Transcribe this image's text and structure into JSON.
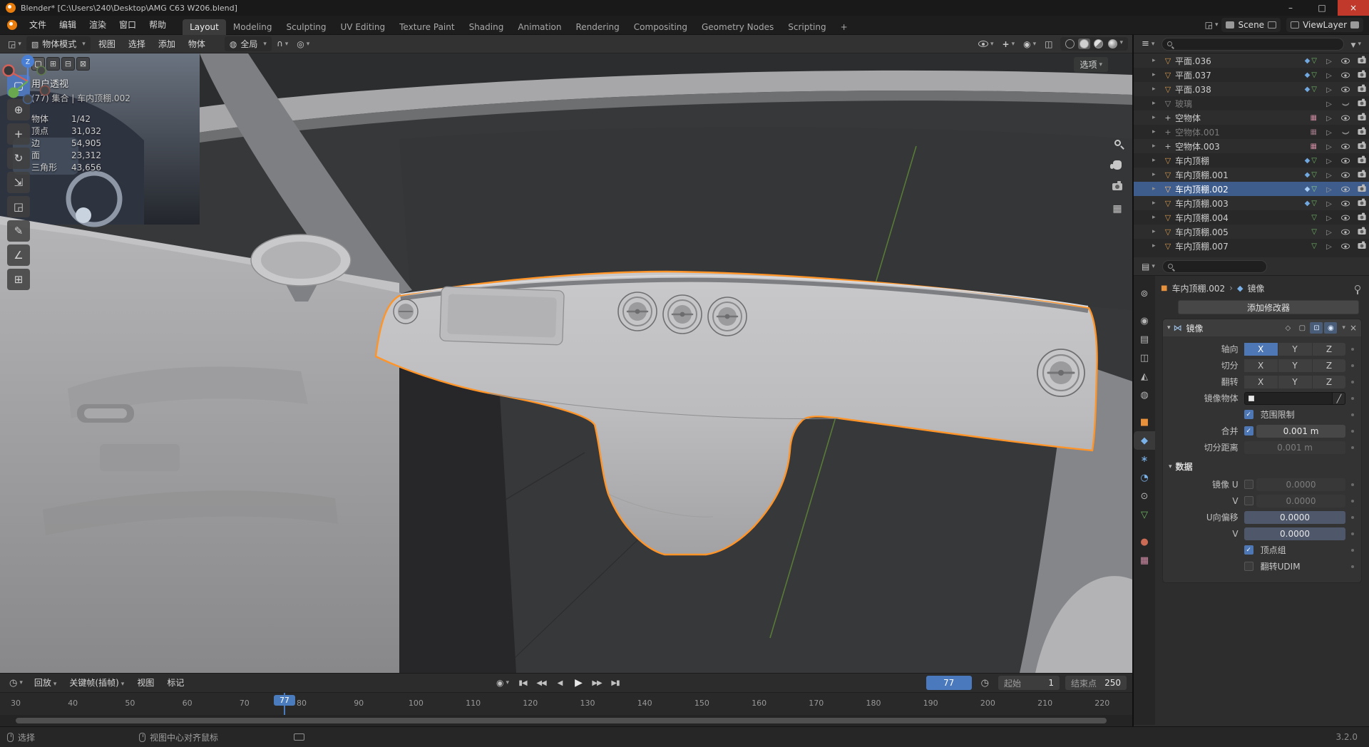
{
  "colors": {
    "accent": "#4772b3",
    "selection_outline": "#ff9428",
    "object_orange": "#e8913d"
  },
  "titlebar": {
    "title": "Blender* [C:\\Users\\240\\Desktop\\AMG C63 W206.blend]",
    "buttons": [
      {
        "name": "minimize-button",
        "glyph": "–"
      },
      {
        "name": "maximize-button",
        "glyph": "□"
      },
      {
        "name": "close-button",
        "glyph": "×",
        "close": true
      }
    ]
  },
  "topbar": {
    "menus": [
      {
        "label": "文件"
      },
      {
        "label": "编辑"
      },
      {
        "label": "渲染"
      },
      {
        "label": "窗口"
      },
      {
        "label": "帮助"
      }
    ],
    "workspaces": [
      {
        "label": "Layout",
        "active": true
      },
      {
        "label": "Modeling"
      },
      {
        "label": "Sculpting"
      },
      {
        "label": "UV Editing"
      },
      {
        "label": "Texture Paint"
      },
      {
        "label": "Shading"
      },
      {
        "label": "Animation"
      },
      {
        "label": "Rendering"
      },
      {
        "label": "Compositing"
      },
      {
        "label": "Geometry Nodes"
      },
      {
        "label": "Scripting"
      },
      {
        "label": "+"
      }
    ],
    "scene_label": "Scene",
    "viewlayer_label": "ViewLayer"
  },
  "viewport": {
    "header": {
      "mode": "物体模式",
      "menus": [
        {
          "label": "视图"
        },
        {
          "label": "选择"
        },
        {
          "label": "添加"
        },
        {
          "label": "物体"
        }
      ],
      "orientation": "全局"
    },
    "tool_settings": {
      "options_label": "选项",
      "select_modes": [
        {
          "name": "select-mode-set",
          "glyph": "▢",
          "active": true
        },
        {
          "name": "select-mode-extend",
          "glyph": "⊞"
        },
        {
          "name": "select-mode-subtract",
          "glyph": "⊟"
        },
        {
          "name": "select-mode-intersect",
          "glyph": "⊠"
        }
      ]
    },
    "toolbar": [
      {
        "name": "select-box-tool",
        "glyph": "▢",
        "active": true
      },
      {
        "name": "cursor-tool",
        "glyph": "⊕"
      },
      {
        "name": "move-tool",
        "glyph": "+"
      },
      {
        "name": "rotate-tool",
        "glyph": "↻"
      },
      {
        "name": "scale-tool",
        "glyph": "⇲"
      },
      {
        "name": "transform-tool",
        "glyph": "◲"
      },
      {
        "name": "annotate-tool",
        "glyph": "✎"
      },
      {
        "name": "measure-tool",
        "glyph": "∠"
      },
      {
        "name": "add-cube-tool",
        "glyph": "⊞"
      }
    ],
    "overlay": {
      "view_label": "用户透视",
      "context_label": "(77) 集合 | 车内顶棚.002",
      "stats": [
        {
          "label": "物体",
          "value": "1/42"
        },
        {
          "label": "顶点",
          "value": "31,032"
        },
        {
          "label": "边",
          "value": "54,905"
        },
        {
          "label": "面",
          "value": "23,312"
        },
        {
          "label": "三角形",
          "value": "43,656"
        }
      ]
    },
    "gizmo": {
      "z_label": "Z"
    }
  },
  "outliner": {
    "rows": [
      {
        "name": "平面.036",
        "icon": {
          "g": "▽",
          "c": "#cf9850"
        },
        "badges": [
          {
            "n": "modifier-badge",
            "g": "◆",
            "c": "#71a8e0"
          },
          {
            "n": "mesh-data-badge",
            "g": "▽",
            "c": "#6db563"
          }
        ]
      },
      {
        "name": "平面.037",
        "icon": {
          "g": "▽",
          "c": "#cf9850"
        },
        "badges": [
          {
            "n": "modifier-badge",
            "g": "◆",
            "c": "#71a8e0"
          },
          {
            "n": "mesh-data-badge",
            "g": "▽",
            "c": "#6db563"
          }
        ]
      },
      {
        "name": "平面.038",
        "icon": {
          "g": "▽",
          "c": "#cf9850"
        },
        "badges": [
          {
            "n": "modifier-badge",
            "g": "◆",
            "c": "#71a8e0"
          },
          {
            "n": "mesh-data-badge",
            "g": "▽",
            "c": "#6db563"
          }
        ]
      },
      {
        "name": "玻璃",
        "dim": true,
        "eyeClosed": true,
        "icon": {
          "g": "▽",
          "c": "#8e8e8e"
        },
        "badges": []
      },
      {
        "name": "空物体",
        "icon": {
          "g": "+",
          "c": "#c0c0c0"
        },
        "badges": [
          {
            "n": "image-badge",
            "g": "▦",
            "c": "#c9899f"
          }
        ]
      },
      {
        "name": "空物体.001",
        "dim": true,
        "eyeClosed": true,
        "icon": {
          "g": "+",
          "c": "#8e8e8e"
        },
        "badges": [
          {
            "n": "image-badge",
            "g": "▦",
            "c": "#9a7583"
          }
        ]
      },
      {
        "name": "空物体.003",
        "icon": {
          "g": "+",
          "c": "#c0c0c0"
        },
        "badges": [
          {
            "n": "image-badge",
            "g": "▦",
            "c": "#c9899f"
          }
        ]
      },
      {
        "name": "车内顶棚",
        "icon": {
          "g": "▽",
          "c": "#cf9850"
        },
        "badges": [
          {
            "n": "modifier-badge",
            "g": "◆",
            "c": "#71a8e0"
          },
          {
            "n": "mesh-data-badge",
            "g": "▽",
            "c": "#6db563"
          }
        ]
      },
      {
        "name": "车内顶棚.001",
        "icon": {
          "g": "▽",
          "c": "#cf9850"
        },
        "badges": [
          {
            "n": "modifier-badge",
            "g": "◆",
            "c": "#71a8e0"
          },
          {
            "n": "mesh-data-badge",
            "g": "▽",
            "c": "#6db563"
          }
        ]
      },
      {
        "name": "车内顶棚.002",
        "selected": true,
        "icon": {
          "g": "▽",
          "c": "#ffc27a"
        },
        "badges": [
          {
            "n": "modifier-badge",
            "g": "◆",
            "c": "#a8cdf2"
          },
          {
            "n": "mesh-data-badge",
            "g": "▽",
            "c": "#8fd687"
          }
        ]
      },
      {
        "name": "车内顶棚.003",
        "icon": {
          "g": "▽",
          "c": "#cf9850"
        },
        "badges": [
          {
            "n": "modifier-badge",
            "g": "◆",
            "c": "#71a8e0"
          },
          {
            "n": "mesh-data-badge",
            "g": "▽",
            "c": "#6db563"
          }
        ]
      },
      {
        "name": "车内顶棚.004",
        "icon": {
          "g": "▽",
          "c": "#cf9850"
        },
        "badges": [
          {
            "n": "mesh-data-badge",
            "g": "▽",
            "c": "#6db563"
          }
        ]
      },
      {
        "name": "车内顶棚.005",
        "icon": {
          "g": "▽",
          "c": "#cf9850"
        },
        "badges": [
          {
            "n": "mesh-data-badge",
            "g": "▽",
            "c": "#6db563"
          }
        ]
      },
      {
        "name": "车内顶棚.007",
        "icon": {
          "g": "▽",
          "c": "#cf9850"
        },
        "badges": [
          {
            "n": "mesh-data-badge",
            "g": "▽",
            "c": "#6db563"
          }
        ]
      }
    ]
  },
  "properties": {
    "tabs": [
      {
        "name": "tool",
        "glyph": "⊚",
        "color": "#b5b5b5"
      },
      {
        "name": "render",
        "glyph": "◉",
        "color": "#b5b5b5",
        "gap": true
      },
      {
        "name": "output",
        "glyph": "▤",
        "color": "#b5b5b5"
      },
      {
        "name": "view-layer",
        "glyph": "◫",
        "color": "#b5b5b5"
      },
      {
        "name": "scene",
        "glyph": "◭",
        "color": "#b5b5b5"
      },
      {
        "name": "world",
        "glyph": "◍",
        "color": "#b5b5b5"
      },
      {
        "name": "object",
        "glyph": "■",
        "color": "#e8913d",
        "gap": true
      },
      {
        "name": "modifiers",
        "glyph": "◆",
        "color": "#79b1e8",
        "active": true
      },
      {
        "name": "particles",
        "glyph": "∗",
        "color": "#79b1e8"
      },
      {
        "name": "physics",
        "glyph": "◔",
        "color": "#79b1e8"
      },
      {
        "name": "constraints",
        "glyph": "⊙",
        "color": "#b5b5b5"
      },
      {
        "name": "object-data",
        "glyph": "▽",
        "color": "#6db563"
      },
      {
        "name": "material",
        "glyph": "●",
        "color": "#cb6a55",
        "gap": true
      },
      {
        "name": "texture",
        "glyph": "▦",
        "color": "#cf8ca5"
      }
    ],
    "breadcrumb": {
      "object": "车内顶棚.002",
      "separator": "›",
      "modifier": "镜像"
    },
    "add_modifier_label": "添加修改器",
    "modifier_panel": {
      "name": "镜像",
      "expand_glyph": "▾",
      "header_toggles": [
        {
          "name": "toggle-on-cage",
          "glyph": "◇"
        },
        {
          "name": "toggle-edit-mode",
          "glyph": "▢"
        },
        {
          "name": "toggle-realtime",
          "glyph": "⊡",
          "active": true
        },
        {
          "name": "toggle-render",
          "glyph": "◉",
          "active": true
        }
      ],
      "close_glyph": "×",
      "axis_rows": [
        {
          "label": "轴向",
          "name": "axis",
          "buttons": [
            {
              "t": "X",
              "active": true
            },
            {
              "t": "Y"
            },
            {
              "t": "Z"
            }
          ]
        },
        {
          "label": "切分",
          "name": "bisect",
          "buttons": [
            {
              "t": "X"
            },
            {
              "t": "Y"
            },
            {
              "t": "Z"
            }
          ]
        },
        {
          "label": "翻转",
          "name": "flip",
          "buttons": [
            {
              "t": "X"
            },
            {
              "t": "Y"
            },
            {
              "t": "Z"
            }
          ]
        }
      ],
      "mirror_object_label": "镜像物体",
      "clipping_label": "范围限制",
      "merge_label": "合并",
      "merge_value": "0.001 m",
      "bisect_distance_label": "切分距离",
      "bisect_distance_value": "0.001 m",
      "data_section_label": "数据",
      "mirror_u_label": "镜像 U",
      "mirror_u_value": "0.0000",
      "mirror_v_label": "V",
      "mirror_v_value": "0.0000",
      "offset_u_label": "U向偏移",
      "offset_u_value": "0.0000",
      "offset_v_label": "V",
      "offset_v_value": "0.0000",
      "vertex_groups_label": "顶点组",
      "flip_udim_label": "翻转UDIM"
    }
  },
  "timeline": {
    "menus": [
      {
        "label": "回放",
        "chev": true
      },
      {
        "label": "关键帧(插帧)",
        "chev": true
      },
      {
        "label": "视图"
      },
      {
        "label": "标记"
      }
    ],
    "transport": [
      {
        "name": "jump-to-start-button",
        "glyph": "▮◀"
      },
      {
        "name": "prev-keyframe-button",
        "glyph": "◀◀"
      },
      {
        "name": "play-reverse-button",
        "glyph": "◀"
      },
      {
        "name": "play-button",
        "glyph": "▶",
        "big": true
      },
      {
        "name": "next-keyframe-button",
        "glyph": "▶▶"
      },
      {
        "name": "jump-to-end-button",
        "glyph": "▶▮"
      }
    ],
    "current_frame": "77",
    "frame_number": 77,
    "start_label": "起始",
    "start_value": "1",
    "end_label": "结束点",
    "end_value": "250",
    "ticks": [
      30,
      40,
      50,
      60,
      70,
      80,
      90,
      100,
      110,
      120,
      130,
      140,
      150,
      160,
      170,
      180,
      190,
      200,
      210,
      220
    ]
  },
  "statusbar": {
    "select_hint": "选择",
    "center_hint": "视图中心对齐鼠标",
    "version": "3.2.0"
  }
}
